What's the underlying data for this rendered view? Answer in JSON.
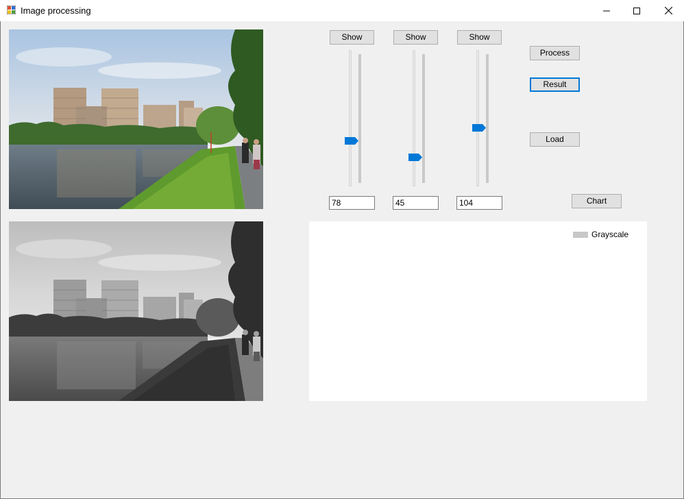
{
  "window": {
    "title": "Image processing",
    "icon": "app-icon",
    "controls": [
      "minimize-icon",
      "maximize-icon",
      "close-icon"
    ]
  },
  "images": {
    "original": "color photo of river embankment with apartment buildings",
    "result": "grayscale version of the same photo"
  },
  "channels": [
    {
      "show_label": "Show",
      "value": "78",
      "slider_level": 78
    },
    {
      "show_label": "Show",
      "value": "45",
      "slider_level": 45
    },
    {
      "show_label": "Show",
      "value": "104",
      "slider_level": 104
    }
  ],
  "slider_range": [
    0,
    255
  ],
  "actions": {
    "process_label": "Process",
    "result_label": "Result",
    "load_label": "Load",
    "chart_label": "Chart"
  },
  "chart": {
    "legend_label": "Grayscale",
    "legend_color": "#c8c8c8"
  },
  "colors": {
    "accent": "#0078d7",
    "background": "#f0f0f0"
  }
}
